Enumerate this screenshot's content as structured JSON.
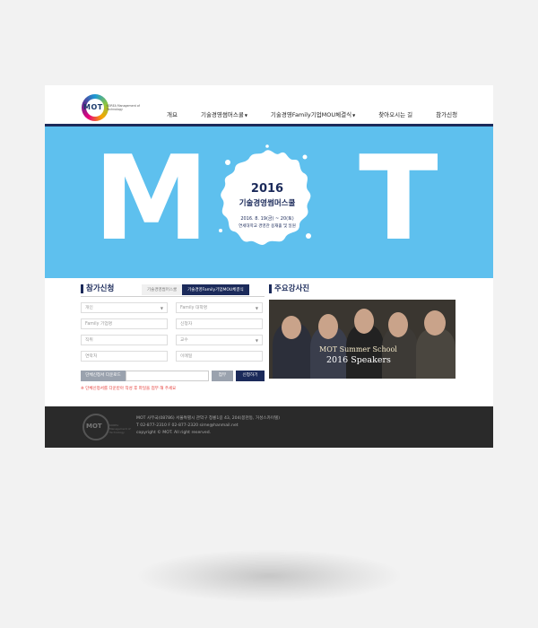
{
  "header": {
    "logo_text": "MOT",
    "logo_sub": "KOREA Management of Technology",
    "nav": [
      {
        "label": "개요",
        "dropdown": false
      },
      {
        "label": "기술경영썸머스쿨",
        "dropdown": true
      },
      {
        "label": "기술경영Family기업MOU체결식",
        "dropdown": true
      },
      {
        "label": "찾아오시는 길",
        "dropdown": false
      },
      {
        "label": "참가신청",
        "dropdown": false
      }
    ]
  },
  "hero": {
    "letter_m": "M",
    "letter_t": "T",
    "year": "2016",
    "title": "기술경영썸머스쿨",
    "date": "2016. 8. 19(금) ~ 20(토)",
    "place": "연세대학교 경영관 용재홀 및 일원",
    "bg_color": "#5ec0ee"
  },
  "registration": {
    "title": "참가신청",
    "tabs": [
      {
        "label": "기술경영썸머스쿨",
        "active": false
      },
      {
        "label": "기술경영Family기업MOU체결식",
        "active": true
      }
    ],
    "fields": {
      "type": "개인",
      "univ": "Family 대학명",
      "company": "Family 기업명",
      "applicant": "신청자",
      "position": "직위",
      "role": "교수",
      "phone": "연락처",
      "email": "이메일"
    },
    "file_label": "단체신청서 다운로드",
    "browse_label": "첨부",
    "apply_label": "신청하기",
    "notice": "※ 단체신청서를 다운받아 작성 후 파일을 첨부 해 주세요"
  },
  "photos": {
    "title": "주요강사진",
    "caption_line1": "MOT Summer School",
    "caption_line2": "2016 Speakers"
  },
  "footer": {
    "logo_text": "MOT",
    "logo_sub": "KOREA Management of Technology",
    "line1": "MOT 사무국(08786) 서울특별시 관악구 청룡1길 43, 204(봉천동, 거성스카이텔)",
    "line2": "T 02-877-2310 F 02-877-2320    sime@hanmail.net",
    "line3": "copyright © MOT. All right reserved."
  }
}
